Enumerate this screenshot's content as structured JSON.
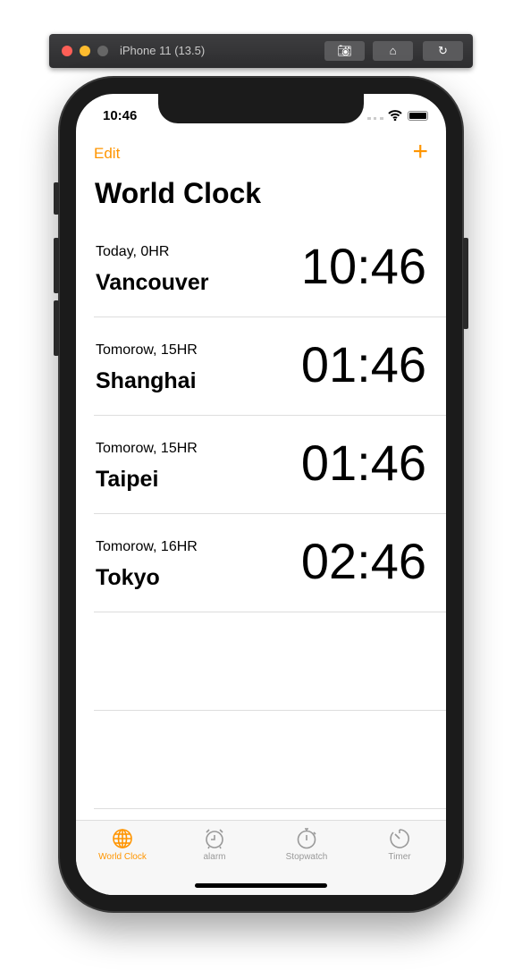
{
  "window": {
    "title": "iPhone 11 (13.5)",
    "buttons": [
      "screenshot-icon",
      "home-icon",
      "rotate-icon"
    ]
  },
  "status": {
    "time": "10:46"
  },
  "nav": {
    "edit": "Edit",
    "add": "+"
  },
  "page_title": "World Clock",
  "clocks": [
    {
      "offset": "Today, 0HR",
      "city": "Vancouver",
      "time": "10:46"
    },
    {
      "offset": "Tomorow, 15HR",
      "city": "Shanghai",
      "time": "01:46"
    },
    {
      "offset": "Tomorow, 15HR",
      "city": "Taipei",
      "time": "01:46"
    },
    {
      "offset": "Tomorow, 16HR",
      "city": "Tokyo",
      "time": "02:46"
    }
  ],
  "tabs": [
    {
      "label": "World Clock",
      "active": true
    },
    {
      "label": "alarm"
    },
    {
      "label": "Stopwatch"
    },
    {
      "label": "Timer"
    }
  ],
  "colors": {
    "accent": "#ff9500",
    "inactive": "#999999"
  }
}
